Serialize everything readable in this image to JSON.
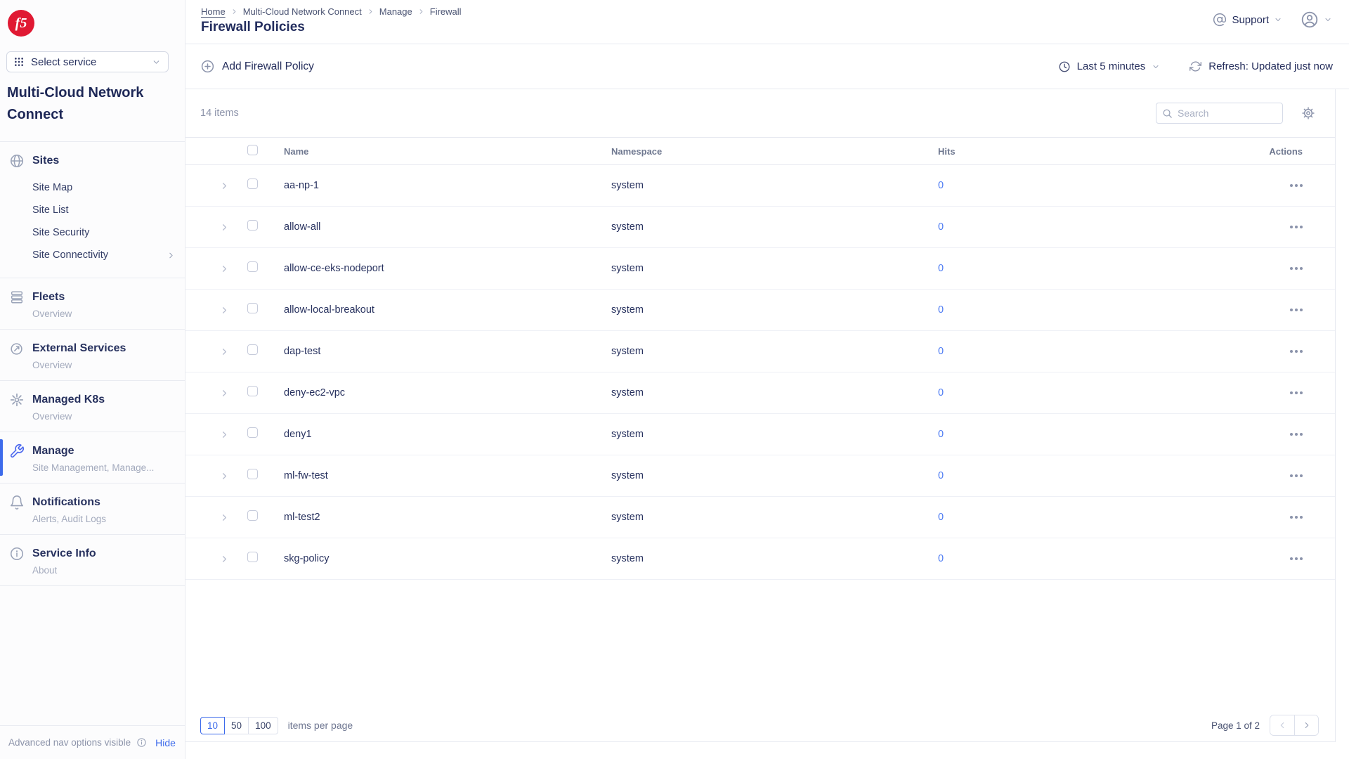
{
  "sidebar": {
    "select_service": "Select service",
    "title": "Multi-Cloud Network Connect",
    "sites": {
      "label": "Sites",
      "children": [
        "Site Map",
        "Site List",
        "Site Security",
        "Site Connectivity"
      ]
    },
    "fleets": {
      "label": "Fleets",
      "subtitle": "Overview"
    },
    "external_services": {
      "label": "External Services",
      "subtitle": "Overview"
    },
    "managed_k8s": {
      "label": "Managed K8s",
      "subtitle": "Overview"
    },
    "manage": {
      "label": "Manage",
      "subtitle": "Site Management, Manage..."
    },
    "notifications": {
      "label": "Notifications",
      "subtitle": "Alerts, Audit Logs"
    },
    "service_info": {
      "label": "Service Info",
      "subtitle": "About"
    },
    "footer": {
      "text": "Advanced nav options visible",
      "hide_link": "Hide"
    }
  },
  "header": {
    "breadcrumb": [
      "Home",
      "Multi-Cloud Network Connect",
      "Manage",
      "Firewall"
    ],
    "title": "Firewall Policies",
    "support": "Support"
  },
  "toolbar": {
    "add_button": "Add Firewall Policy",
    "time_range": "Last 5 minutes",
    "refresh": "Refresh: Updated just now"
  },
  "table": {
    "items_count": "14 items",
    "search_placeholder": "Search",
    "columns": {
      "name": "Name",
      "namespace": "Namespace",
      "hits": "Hits",
      "actions": "Actions"
    },
    "rows": [
      {
        "name": "aa-np-1",
        "namespace": "system",
        "hits": "0"
      },
      {
        "name": "allow-all",
        "namespace": "system",
        "hits": "0"
      },
      {
        "name": "allow-ce-eks-nodeport",
        "namespace": "system",
        "hits": "0"
      },
      {
        "name": "allow-local-breakout",
        "namespace": "system",
        "hits": "0"
      },
      {
        "name": "dap-test",
        "namespace": "system",
        "hits": "0"
      },
      {
        "name": "deny-ec2-vpc",
        "namespace": "system",
        "hits": "0"
      },
      {
        "name": "deny1",
        "namespace": "system",
        "hits": "0"
      },
      {
        "name": "ml-fw-test",
        "namespace": "system",
        "hits": "0"
      },
      {
        "name": "ml-test2",
        "namespace": "system",
        "hits": "0"
      },
      {
        "name": "skg-policy",
        "namespace": "system",
        "hits": "0"
      }
    ]
  },
  "pagination": {
    "sizes": [
      "10",
      "50",
      "100"
    ],
    "active_size": "10",
    "label": "items per page",
    "page_info": "Page 1 of 2"
  },
  "colors": {
    "accent_blue": "#3d6beb",
    "navy": "#28325f",
    "brand_red": "#e01933",
    "link_blue": "#4d7bf3"
  },
  "brand": {
    "logo_text": "f5"
  }
}
